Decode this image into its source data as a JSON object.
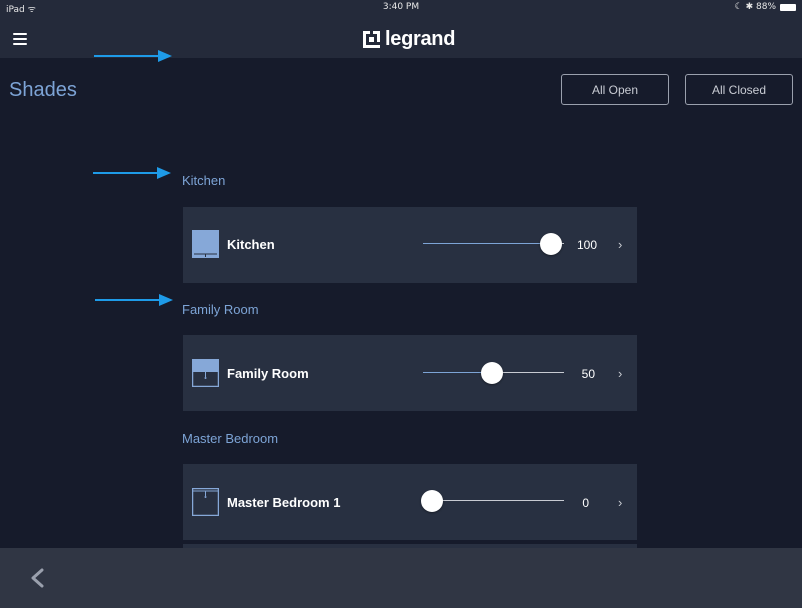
{
  "status_bar": {
    "left": "iPad ᯤ",
    "time": "3:40 PM",
    "right": "☾ ✱ 88%"
  },
  "header": {
    "logo_text": "legrand",
    "menu_icon": "hamburger-menu-icon"
  },
  "page": {
    "title": "Shades",
    "all_open_label": "All Open",
    "all_closed_label": "All Closed"
  },
  "rooms": [
    {
      "section": "Kitchen",
      "shade": "Kitchen",
      "value": "100",
      "level": 1.0,
      "icon": "shade-open-icon"
    },
    {
      "section": "Family Room",
      "shade": "Family Room",
      "value": "50",
      "level": 0.5,
      "icon": "shade-half-icon"
    },
    {
      "section": "Master Bedroom",
      "shade": "Master Bedroom 1",
      "value": "0",
      "level": 0.0,
      "icon": "shade-closed-icon"
    }
  ],
  "footer": {
    "back_icon": "chevron-left-icon"
  },
  "colors": {
    "background": "#161b2b",
    "bars": "#242a3a",
    "accent": "#7da4d6",
    "card": "#283041",
    "annotation_arrow": "#1e9be8"
  }
}
